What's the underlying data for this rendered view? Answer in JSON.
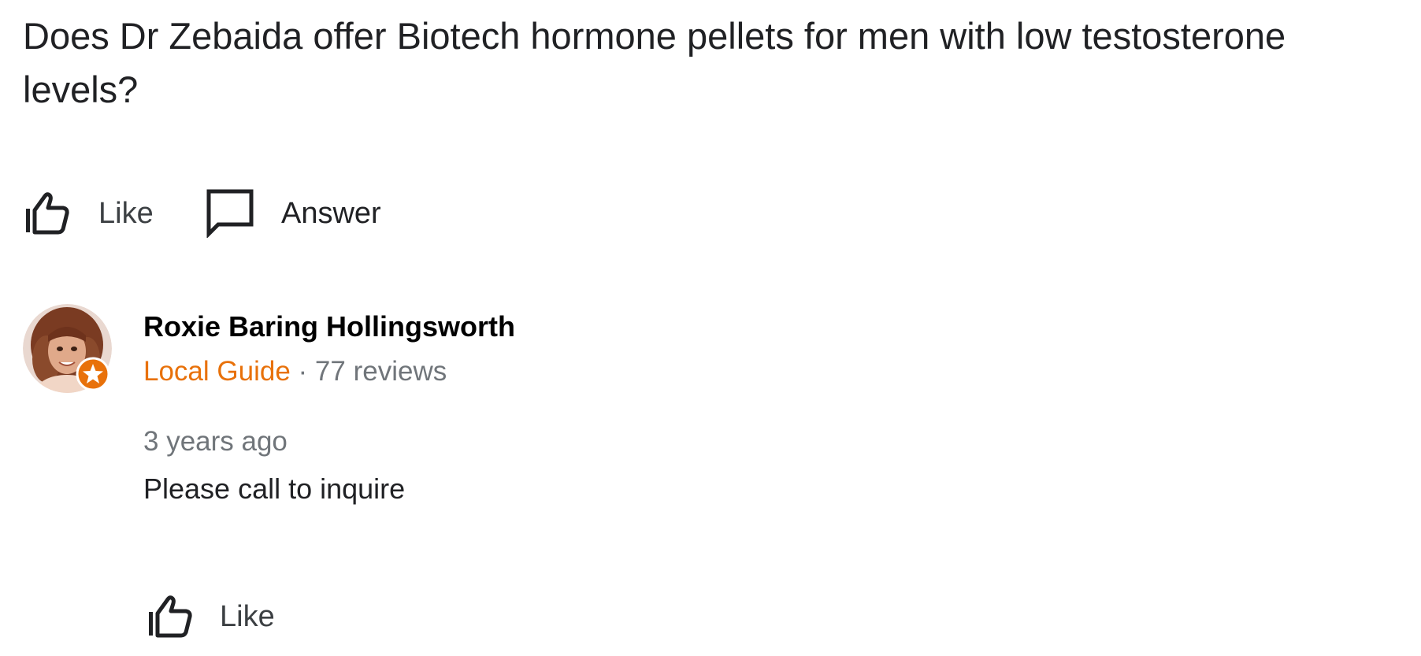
{
  "question": {
    "text": "Does Dr Zebaida offer Biotech hormone pellets for men with low testosterone levels?",
    "like_label": "Like",
    "answer_label": "Answer"
  },
  "answer": {
    "author": {
      "name": "Roxie Baring Hollingsworth",
      "badge": "Local Guide",
      "separator": "·",
      "reviews": "77 reviews",
      "avatar_icon": "profile-photo",
      "badge_icon": "local-guide-star-icon"
    },
    "timestamp": "3 years ago",
    "text": "Please call to inquire",
    "like_label": "Like"
  },
  "colors": {
    "text_primary": "#202124",
    "text_secondary": "#70757a",
    "local_guide": "#e8710a",
    "icon": "#202124"
  }
}
